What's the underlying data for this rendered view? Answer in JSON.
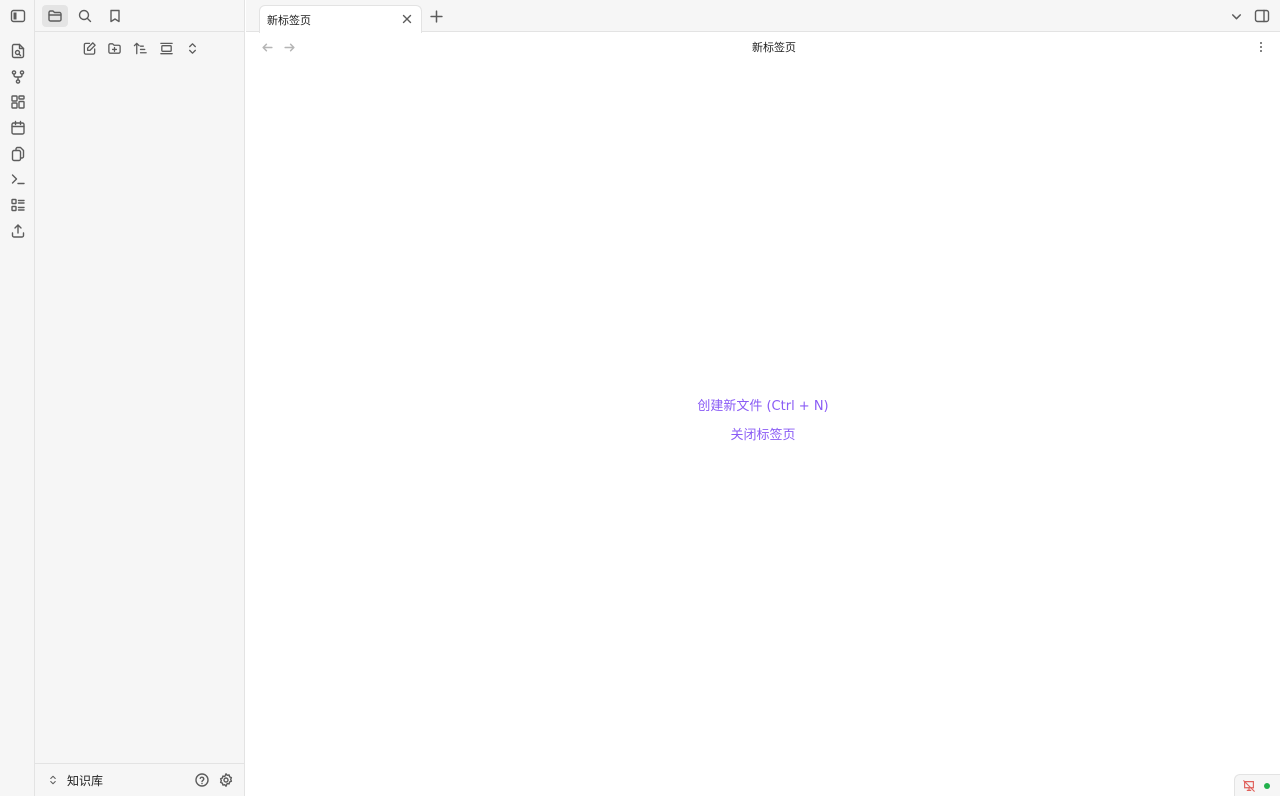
{
  "tabs": [
    {
      "title": "新标签页"
    }
  ],
  "view": {
    "title": "新标签页"
  },
  "empty_state": {
    "create_new_file": "创建新文件 (Ctrl + N)",
    "close_tab": "关闭标签页"
  },
  "sidebar": {
    "vault_name": "知识库",
    "active_tab": "file-explorer"
  },
  "colors": {
    "accent": "#8a5cf5",
    "status_dot": "#22b14c",
    "sync_icon": "#e0605a"
  }
}
